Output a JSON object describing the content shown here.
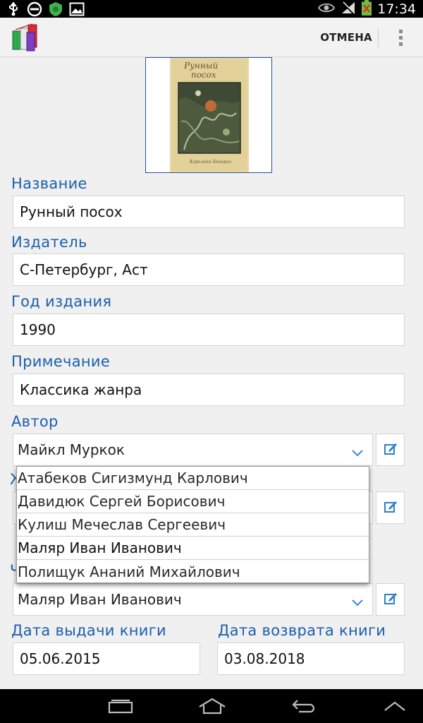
{
  "status_bar": {
    "time": "17:34",
    "left_icons": [
      "usb-icon",
      "do-not-disturb-icon",
      "shield-app-icon",
      "image-icon"
    ],
    "right_icons": [
      "eye-icon",
      "signal-off-icon",
      "battery-icon"
    ]
  },
  "action_bar": {
    "cancel_label": "ОТМЕНА",
    "overflow_icon": "more-vert-icon"
  },
  "cover": {
    "title_text": "Рунный посох",
    "author_text": "Кэролайн Хейнрих"
  },
  "form": {
    "title_label": "Название",
    "title_value": "Рунный посох",
    "publisher_label": "Издатель",
    "publisher_value": "С-Петербург, Аст",
    "year_label": "Год  издания",
    "year_value": "1990",
    "note_label": "Примечание",
    "note_value": "Классика жанра",
    "author_label": "Автор",
    "author_value": "Майкл Муркок",
    "genre_label_partial": "Ж",
    "reader_label_partial": "Ч",
    "reader_value": "Маляр Иван Иванович",
    "issue_date_label": "Дата  выдачи  книги",
    "issue_date_value": "05.06.2015",
    "return_date_label": "Дата  возврата  книги",
    "return_date_value": "03.08.2018"
  },
  "dropdown": {
    "items": [
      "Атабеков Сигизмунд Карлович",
      "Давидюк Сергей Борисович",
      "Кулиш Мечеслав Сергеевич",
      "Маляр Иван Иванович",
      "Полищук Ананий Михайлович"
    ]
  },
  "nav_bar": {
    "icons": [
      "recent-apps-icon",
      "home-icon",
      "back-icon",
      "collapse-up-icon"
    ]
  },
  "colors": {
    "label_blue": "#1b5fae",
    "edit_icon_blue": "#2a7fd0",
    "status_bar": "#000000"
  }
}
